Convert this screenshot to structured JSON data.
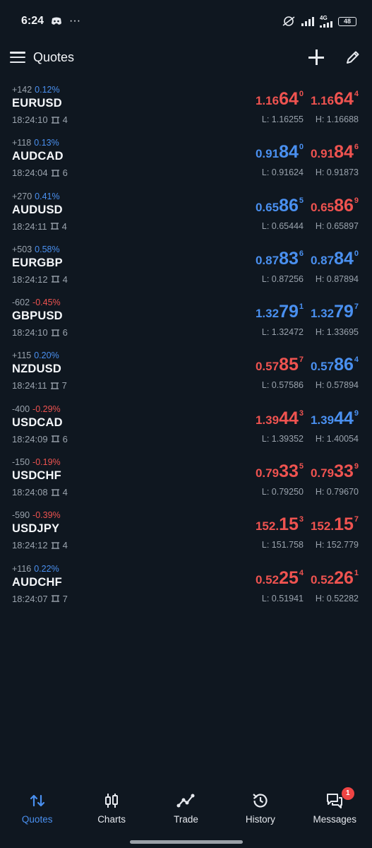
{
  "status_bar": {
    "time": "6:24",
    "dots": "···",
    "net_tag": "4G",
    "battery": "48"
  },
  "app_bar": {
    "title": "Quotes"
  },
  "quotes": [
    {
      "pts": "+142",
      "pct": "0.12%",
      "dir": "up",
      "symbol": "EURUSD",
      "time": "18:24:10",
      "spread": "4",
      "bid": {
        "pre": "1.16",
        "big": "64",
        "sup": "0",
        "color": "red"
      },
      "ask": {
        "pre": "1.16",
        "big": "64",
        "sup": "4",
        "color": "red"
      },
      "low": "L: 1.16255",
      "high": "H: 1.16688"
    },
    {
      "pts": "+118",
      "pct": "0.13%",
      "dir": "up",
      "symbol": "AUDCAD",
      "time": "18:24:04",
      "spread": "6",
      "bid": {
        "pre": "0.91",
        "big": "84",
        "sup": "0",
        "color": "blue"
      },
      "ask": {
        "pre": "0.91",
        "big": "84",
        "sup": "6",
        "color": "red"
      },
      "low": "L: 0.91624",
      "high": "H: 0.91873"
    },
    {
      "pts": "+270",
      "pct": "0.41%",
      "dir": "up",
      "symbol": "AUDUSD",
      "time": "18:24:11",
      "spread": "4",
      "bid": {
        "pre": "0.65",
        "big": "86",
        "sup": "5",
        "color": "blue"
      },
      "ask": {
        "pre": "0.65",
        "big": "86",
        "sup": "9",
        "color": "red"
      },
      "low": "L: 0.65444",
      "high": "H: 0.65897"
    },
    {
      "pts": "+503",
      "pct": "0.58%",
      "dir": "up",
      "symbol": "EURGBP",
      "time": "18:24:12",
      "spread": "4",
      "bid": {
        "pre": "0.87",
        "big": "83",
        "sup": "6",
        "color": "blue"
      },
      "ask": {
        "pre": "0.87",
        "big": "84",
        "sup": "0",
        "color": "blue"
      },
      "low": "L: 0.87256",
      "high": "H: 0.87894"
    },
    {
      "pts": "-602",
      "pct": "-0.45%",
      "dir": "down",
      "symbol": "GBPUSD",
      "time": "18:24:10",
      "spread": "6",
      "bid": {
        "pre": "1.32",
        "big": "79",
        "sup": "1",
        "color": "blue"
      },
      "ask": {
        "pre": "1.32",
        "big": "79",
        "sup": "7",
        "color": "blue"
      },
      "low": "L: 1.32472",
      "high": "H: 1.33695"
    },
    {
      "pts": "+115",
      "pct": "0.20%",
      "dir": "up",
      "symbol": "NZDUSD",
      "time": "18:24:11",
      "spread": "7",
      "bid": {
        "pre": "0.57",
        "big": "85",
        "sup": "7",
        "color": "red"
      },
      "ask": {
        "pre": "0.57",
        "big": "86",
        "sup": "4",
        "color": "blue"
      },
      "low": "L: 0.57586",
      "high": "H: 0.57894"
    },
    {
      "pts": "-400",
      "pct": "-0.29%",
      "dir": "down",
      "symbol": "USDCAD",
      "time": "18:24:09",
      "spread": "6",
      "bid": {
        "pre": "1.39",
        "big": "44",
        "sup": "3",
        "color": "red"
      },
      "ask": {
        "pre": "1.39",
        "big": "44",
        "sup": "9",
        "color": "blue"
      },
      "low": "L: 1.39352",
      "high": "H: 1.40054"
    },
    {
      "pts": "-150",
      "pct": "-0.19%",
      "dir": "down",
      "symbol": "USDCHF",
      "time": "18:24:08",
      "spread": "4",
      "bid": {
        "pre": "0.79",
        "big": "33",
        "sup": "5",
        "color": "red"
      },
      "ask": {
        "pre": "0.79",
        "big": "33",
        "sup": "9",
        "color": "red"
      },
      "low": "L: 0.79250",
      "high": "H: 0.79670"
    },
    {
      "pts": "-590",
      "pct": "-0.39%",
      "dir": "down",
      "symbol": "USDJPY",
      "time": "18:24:12",
      "spread": "4",
      "bid": {
        "pre": "152.",
        "big": "15",
        "sup": "3",
        "color": "red"
      },
      "ask": {
        "pre": "152.",
        "big": "15",
        "sup": "7",
        "color": "red"
      },
      "low": "L: 151.758",
      "high": "H: 152.779"
    },
    {
      "pts": "+116",
      "pct": "0.22%",
      "dir": "up",
      "symbol": "AUDCHF",
      "time": "18:24:07",
      "spread": "7",
      "bid": {
        "pre": "0.52",
        "big": "25",
        "sup": "4",
        "color": "red"
      },
      "ask": {
        "pre": "0.52",
        "big": "26",
        "sup": "1",
        "color": "red"
      },
      "low": "L: 0.51941",
      "high": "H: 0.52282"
    }
  ],
  "bottom_nav": {
    "items": [
      {
        "label": "Quotes",
        "icon": "quotes-icon",
        "active": true
      },
      {
        "label": "Charts",
        "icon": "charts-icon",
        "active": false
      },
      {
        "label": "Trade",
        "icon": "trade-icon",
        "active": false
      },
      {
        "label": "History",
        "icon": "history-icon",
        "active": false
      },
      {
        "label": "Messages",
        "icon": "messages-icon",
        "active": false
      }
    ],
    "messages_badge": "1"
  },
  "colors": {
    "background": "#0f1720",
    "up_blue": "#4a90f0",
    "down_red": "#ef5350",
    "muted": "#9aa3ad"
  }
}
